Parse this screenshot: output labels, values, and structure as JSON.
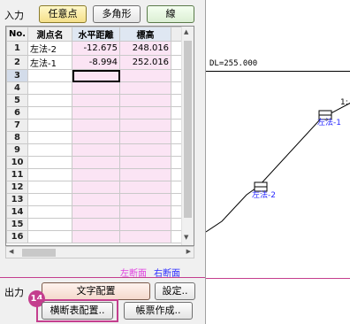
{
  "input_section": {
    "label": "入力",
    "buttons": [
      "任意点",
      "多角形",
      "線"
    ]
  },
  "table": {
    "headers": [
      "No.",
      "測点名",
      "水平距離",
      "標高"
    ],
    "rows": [
      {
        "no": "1",
        "name": "左法-2",
        "dist": "-12.675",
        "elev": "248.016"
      },
      {
        "no": "2",
        "name": "左法-1",
        "dist": "-8.994",
        "elev": "252.016"
      },
      {
        "no": "3",
        "name": "",
        "dist": "",
        "elev": ""
      },
      {
        "no": "4",
        "name": "",
        "dist": "",
        "elev": ""
      },
      {
        "no": "5",
        "name": "",
        "dist": "",
        "elev": ""
      },
      {
        "no": "6",
        "name": "",
        "dist": "",
        "elev": ""
      },
      {
        "no": "7",
        "name": "",
        "dist": "",
        "elev": ""
      },
      {
        "no": "8",
        "name": "",
        "dist": "",
        "elev": ""
      },
      {
        "no": "9",
        "name": "",
        "dist": "",
        "elev": ""
      },
      {
        "no": "10",
        "name": "",
        "dist": "",
        "elev": ""
      },
      {
        "no": "11",
        "name": "",
        "dist": "",
        "elev": ""
      },
      {
        "no": "12",
        "name": "",
        "dist": "",
        "elev": ""
      },
      {
        "no": "13",
        "name": "",
        "dist": "",
        "elev": ""
      },
      {
        "no": "14",
        "name": "",
        "dist": "",
        "elev": ""
      },
      {
        "no": "15",
        "name": "",
        "dist": "",
        "elev": ""
      },
      {
        "no": "16",
        "name": "",
        "dist": "",
        "elev": ""
      }
    ]
  },
  "legend": {
    "left": "左断面",
    "right": "右断面",
    "left_color": "#e040e0",
    "right_color": "#2a2aff"
  },
  "output_section": {
    "label": "出力",
    "text_place": "文字配置",
    "settings": "設定..",
    "cross_section_place": "横断表配置..",
    "ledger_create": "帳票作成.."
  },
  "step_badge": "14",
  "canvas": {
    "dl_label": "DL=255.000",
    "point_labels": [
      "左法-1",
      "左法-2"
    ],
    "corner_text": "1:"
  },
  "colors": {
    "separator": "#c43e8e",
    "highlight_box": "#c43e8e"
  }
}
